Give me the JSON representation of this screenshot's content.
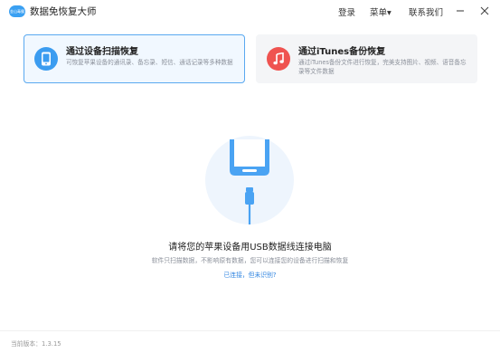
{
  "app": {
    "logo_text": "金山毒霸",
    "title": "数据免恢复大师"
  },
  "menu": {
    "login": "登录",
    "menu": "菜单▾",
    "contact": "联系我们"
  },
  "modes": [
    {
      "title": "通过设备扫描恢复",
      "description": "可恢复苹果设备的通讯录、备忘录、短信、通话记录等多种数据",
      "selected": true,
      "icon": "phone-icon",
      "icon_color": "#3b9cf0"
    },
    {
      "title": "通过iTunes备份恢复",
      "description": "通过iTunes备份文件进行恢复，完美支持图片、视频、语音备忘录等文件数据",
      "selected": false,
      "icon": "music-note-icon",
      "icon_color": "#ef5350"
    }
  ],
  "main": {
    "headline": "请将您的苹果设备用USB数据线连接电脑",
    "subtext": "软件只扫描数据，不影响原有数据，您可以连接您的设备进行扫描和恢复",
    "link": "已连接，但未识别?"
  },
  "footer": {
    "version": "当前版本：1.3.15"
  },
  "colors": {
    "accent": "#3b9cf0",
    "link": "#2f84e0"
  }
}
